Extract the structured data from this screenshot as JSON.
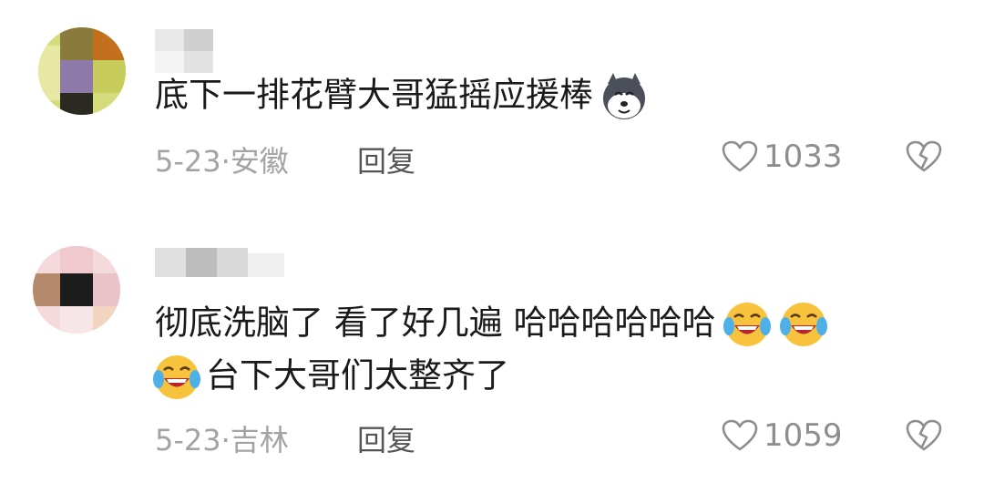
{
  "comments": [
    {
      "lines": [
        "底下一排花臂大哥猛摇应援棒"
      ],
      "line_emojis": [
        [
          "husky-emoji"
        ]
      ],
      "date": "5-23",
      "location": "安徽",
      "reply_label": "回复",
      "likes": "1033"
    },
    {
      "lines": [
        "彻底洗脑了 看了好几遍 哈哈哈哈哈哈",
        "台下大哥们太整齐了"
      ],
      "line_emojis": [
        [
          "laugh-cry-emoji",
          "laugh-cry-emoji"
        ],
        [
          "laugh-cry-emoji"
        ]
      ],
      "date": "5-23",
      "location": "吉林",
      "reply_label": "回复",
      "likes": "1059"
    }
  ],
  "separator": "·",
  "colors": {
    "text": "#1a1a1a",
    "meta": "#a3a3a3",
    "icon": "#8e8e8e",
    "emoji_yellow": "#f7c33c"
  }
}
